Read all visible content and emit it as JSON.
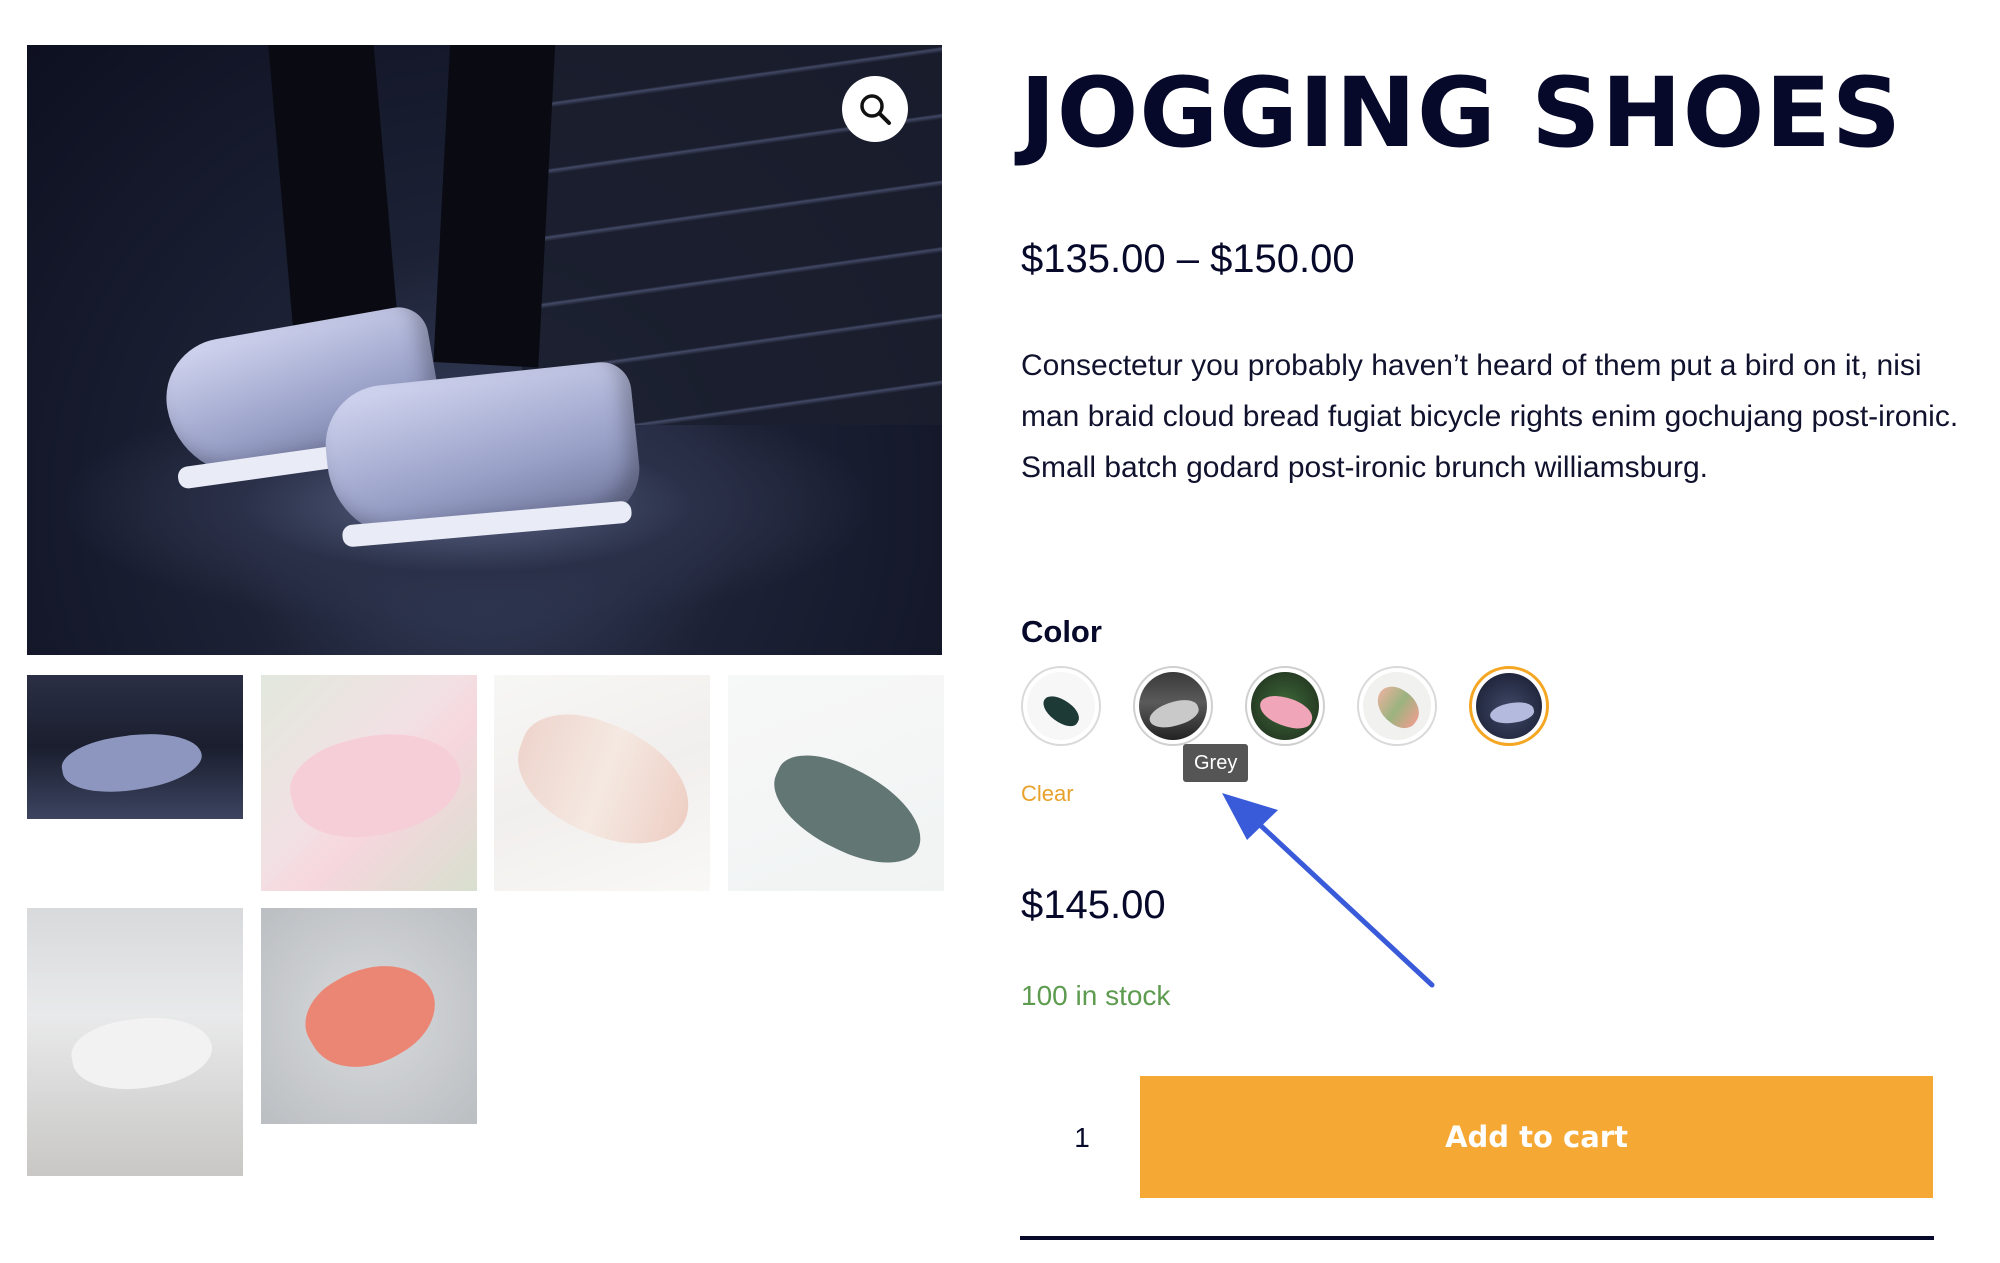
{
  "product": {
    "title": "JOGGING SHOES",
    "price_range": "$135.00 – $150.00",
    "description": "Consectetur you probably haven’t heard of them put a bird on it, nisi man braid cloud bread fugiat bicycle rights enim gochujang post-ironic. Small batch godard post-ironic brunch williamsburg."
  },
  "gallery": {
    "zoom_icon": "search-icon",
    "thumbnails": 6
  },
  "variations": {
    "label": "Color",
    "swatches": [
      "white",
      "grey",
      "pink",
      "multicolor",
      "blue"
    ],
    "selected": "blue",
    "hover_tooltip": "Grey",
    "clear_label": "Clear",
    "price": "$145.00",
    "stock": "100 in stock"
  },
  "cart": {
    "quantity": "1",
    "add_label": "Add to cart"
  },
  "colors": {
    "accent": "#f5a833",
    "title": "#07092a",
    "stock": "#5d9b4f",
    "clear_link": "#e8a22b",
    "tooltip_bg": "#555555",
    "annotation_arrow": "#3a5bd9"
  }
}
